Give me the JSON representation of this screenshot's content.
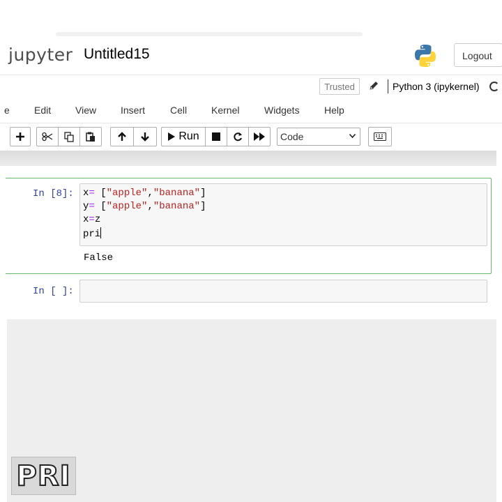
{
  "header": {
    "logo_text": "jupyter",
    "notebook_title": "Untitled15",
    "logout_label": "Logout",
    "python_logo_icon": "python-logo-icon"
  },
  "kernel_bar": {
    "trusted_label": "Trusted",
    "kernel_name": "Python 3 (ipykernel)"
  },
  "menu": {
    "items": [
      "e",
      "Edit",
      "View",
      "Insert",
      "Cell",
      "Kernel",
      "Widgets",
      "Help"
    ]
  },
  "toolbar": {
    "run_label": "Run",
    "cell_type": "Code",
    "icons": [
      "plus-icon",
      "cut-icon",
      "copy-icon",
      "paste-icon",
      "arrow-up-icon",
      "arrow-down-icon",
      "play-icon",
      "stop-icon",
      "restart-icon",
      "fast-forward-icon",
      "keyboard-icon"
    ]
  },
  "cells": [
    {
      "prompt": "In [8]:",
      "lines": [
        {
          "parts": [
            {
              "t": "x",
              "c": "plain"
            },
            {
              "t": "=",
              "c": "op"
            },
            {
              "t": " [",
              "c": "plain"
            },
            {
              "t": "\"apple\"",
              "c": "str"
            },
            {
              "t": ",",
              "c": "plain"
            },
            {
              "t": "\"banana\"",
              "c": "str"
            },
            {
              "t": "]",
              "c": "plain"
            }
          ]
        },
        {
          "parts": [
            {
              "t": "y",
              "c": "plain"
            },
            {
              "t": "=",
              "c": "op"
            },
            {
              "t": " [",
              "c": "plain"
            },
            {
              "t": "\"apple\"",
              "c": "str"
            },
            {
              "t": ",",
              "c": "plain"
            },
            {
              "t": "\"banana\"",
              "c": "str"
            },
            {
              "t": "]",
              "c": "plain"
            }
          ]
        },
        {
          "parts": [
            {
              "t": "x",
              "c": "plain"
            },
            {
              "t": "=",
              "c": "op"
            },
            {
              "t": "z",
              "c": "plain"
            }
          ]
        },
        {
          "parts": [
            {
              "t": "pri",
              "c": "plain"
            }
          ]
        }
      ],
      "output": "False"
    },
    {
      "prompt": "In [ ]:"
    }
  ],
  "watermark_text": "PRI",
  "colors": {
    "selected_cell_border": "#66bb6a",
    "prompt_color": "#303f9f",
    "string_color": "#ba2121",
    "operator_color": "#aa22ff"
  }
}
